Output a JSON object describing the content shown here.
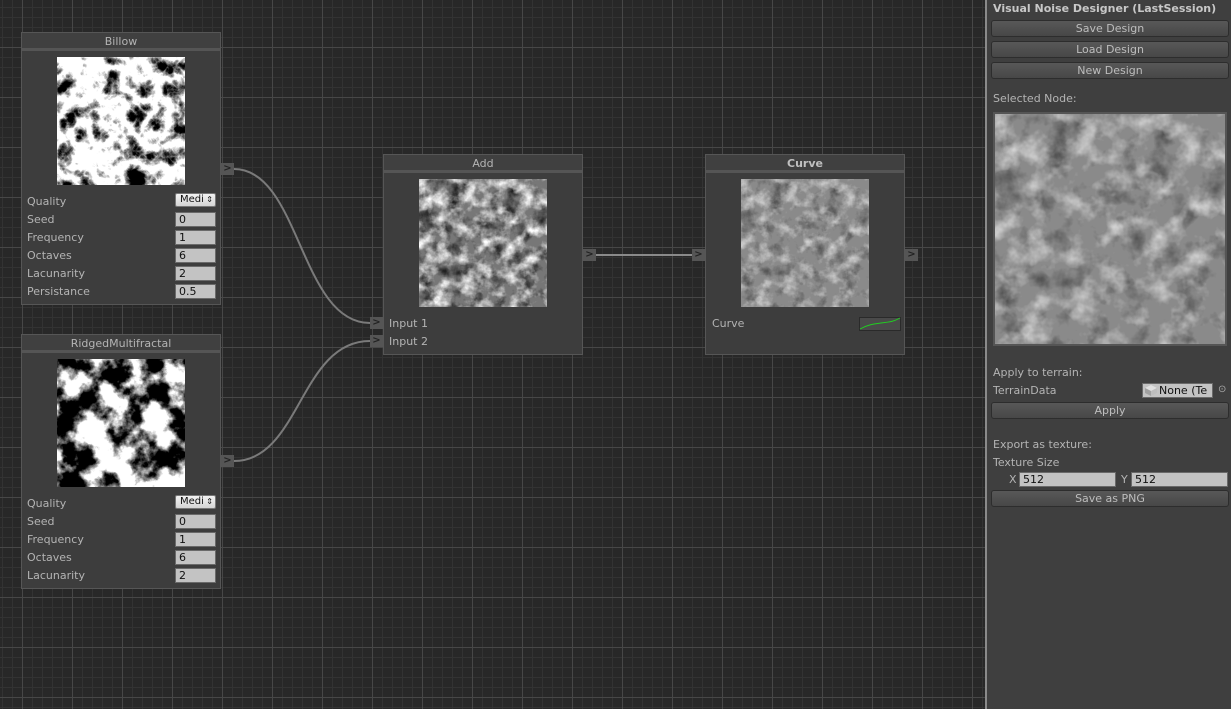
{
  "canvas": {
    "nodes": {
      "billow": {
        "title": "Billow",
        "preview": "billow-noise-preview",
        "fields": [
          {
            "label": "Quality",
            "type": "select",
            "value": "Medi"
          },
          {
            "label": "Seed",
            "type": "input",
            "value": "0"
          },
          {
            "label": "Frequency",
            "type": "input",
            "value": "1"
          },
          {
            "label": "Octaves",
            "type": "input",
            "value": "6"
          },
          {
            "label": "Lacunarity",
            "type": "input",
            "value": "2"
          },
          {
            "label": "Persistance",
            "type": "input",
            "value": "0.5"
          }
        ],
        "output_port": ">"
      },
      "ridged": {
        "title": "RidgedMultifractal",
        "preview": "ridged-noise-preview",
        "fields": [
          {
            "label": "Quality",
            "type": "select",
            "value": "Medi"
          },
          {
            "label": "Seed",
            "type": "input",
            "value": "0"
          },
          {
            "label": "Frequency",
            "type": "input",
            "value": "1"
          },
          {
            "label": "Octaves",
            "type": "input",
            "value": "6"
          },
          {
            "label": "Lacunarity",
            "type": "input",
            "value": "2"
          }
        ],
        "output_port": ">"
      },
      "add": {
        "title": "Add",
        "preview": "add-noise-preview",
        "inputs": [
          "Input 1",
          "Input 2"
        ],
        "output_port": ">"
      },
      "curve": {
        "title": "Curve",
        "preview": "curve-noise-preview",
        "field_label": "Curve",
        "curve_color": "#22cc22",
        "output_port": ">"
      }
    },
    "port_glyph": ">",
    "select_arrows": "⇕"
  },
  "panel": {
    "title": "Visual Noise Designer (LastSession)",
    "buttons": {
      "save_design": "Save Design",
      "load_design": "Load Design",
      "new_design": "New Design",
      "apply": "Apply",
      "save_png": "Save as PNG"
    },
    "selected_node_label": "Selected Node:",
    "apply_terrain_label": "Apply to terrain:",
    "terrain_data_label": "TerrainData",
    "terrain_data_value": "None (Te",
    "picker_glyph": "⊙",
    "export_label": "Export as texture:",
    "texture_size_label": "Texture Size",
    "texture_x_label": "X",
    "texture_x_value": "512",
    "texture_y_label": "Y",
    "texture_y_value": "512"
  }
}
